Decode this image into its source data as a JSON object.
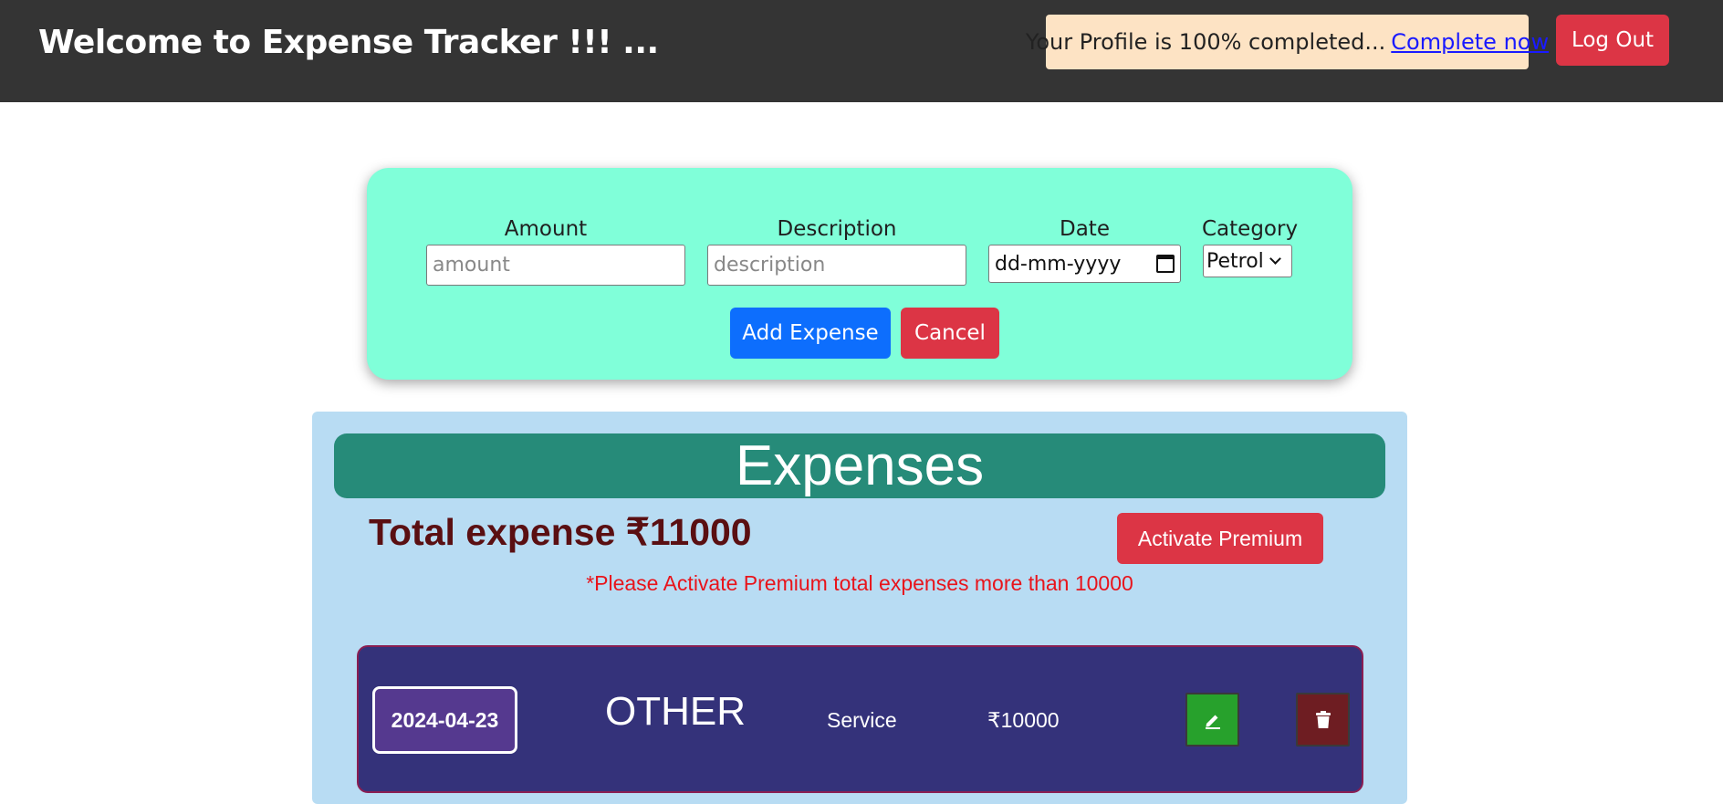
{
  "header": {
    "title": "Welcome to Expense Tracker !!! ...",
    "profile_text": "Your Profile is 100% completed...",
    "profile_link": "Complete now",
    "logout_label": "Log Out"
  },
  "form": {
    "amount_label": "Amount",
    "amount_placeholder": "amount",
    "description_label": "Description",
    "description_placeholder": "description",
    "date_label": "Date",
    "date_placeholder": "dd-mm-yyyy",
    "category_label": "Category",
    "category_value": "Petrol",
    "add_label": "Add Expense",
    "cancel_label": "Cancel"
  },
  "expenses": {
    "title": "Expenses",
    "total_text": "Total expense ₹11000",
    "premium_label": "Activate Premium",
    "notice": "*Please Activate Premium total expenses more than 10000",
    "items": [
      {
        "date": "2024-04-23",
        "category": "OTHER",
        "description": "Service",
        "amount": "₹10000",
        "edit_icon": "pencil-icon",
        "delete_icon": "trash-icon"
      }
    ]
  },
  "colors": {
    "header_bg": "#343434",
    "form_bg": "#80ffd9",
    "panel_bg": "#b8dcf3",
    "title_bg": "#268b79",
    "row_bg": "#34327a",
    "danger": "#dc3545",
    "primary": "#0d6efd",
    "success": "#27a12c"
  }
}
